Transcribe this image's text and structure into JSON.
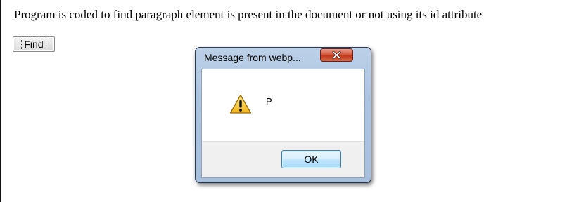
{
  "page": {
    "intro_text": "Program is coded to find paragraph element is present in the document or not using its id attribute",
    "find_button_label": "Find"
  },
  "dialog": {
    "title": "Message from webp...",
    "message": "P",
    "ok_label": "OK",
    "icons": {
      "close": "close-icon",
      "message": "warning-icon"
    }
  },
  "colors": {
    "dialog_frame": "#aac3df",
    "close_button": "#c1391c",
    "ok_button": "#bee6fd",
    "warning_fill": "#f2c230"
  }
}
